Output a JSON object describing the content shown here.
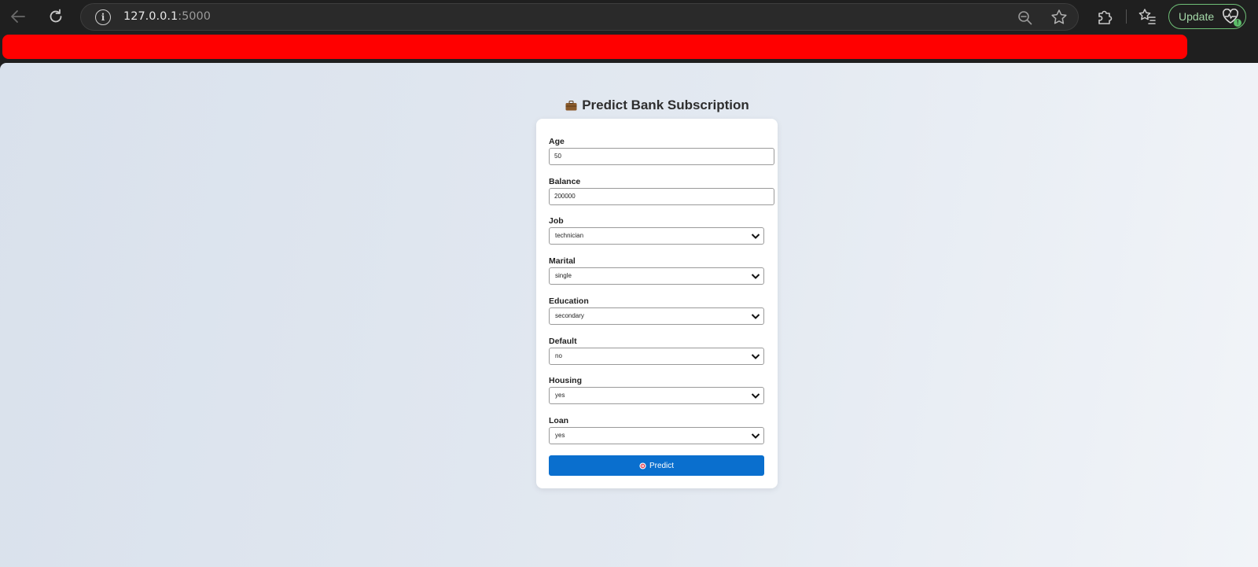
{
  "browser": {
    "url_host": "127.0.0.1",
    "url_port": ":5000",
    "update_label": "Update",
    "update_badge": "!"
  },
  "page": {
    "title": "Predict Bank Subscription",
    "title_icon": "briefcase-icon"
  },
  "form": {
    "age": {
      "label": "Age",
      "value": "50"
    },
    "balance": {
      "label": "Balance",
      "value": "200000"
    },
    "job": {
      "label": "Job",
      "value": "technician"
    },
    "marital": {
      "label": "Marital",
      "value": "single"
    },
    "education": {
      "label": "Education",
      "value": "secondary"
    },
    "default": {
      "label": "Default",
      "value": "no"
    },
    "housing": {
      "label": "Housing",
      "value": "yes"
    },
    "loan": {
      "label": "Loan",
      "value": "yes"
    },
    "submit_label": "Predict",
    "submit_icon": "target-icon"
  },
  "colors": {
    "accent": "#0a6fce",
    "red_bar": "#ff0000",
    "update_green": "#6fbf77"
  }
}
